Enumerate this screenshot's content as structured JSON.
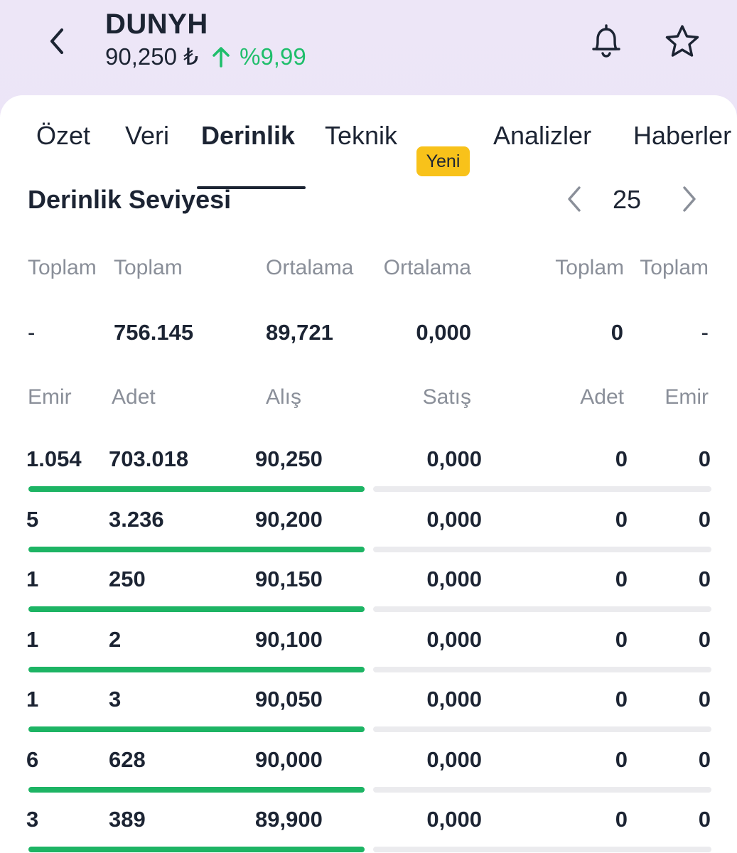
{
  "header": {
    "ticker": "DUNYH",
    "price": "90,250 ₺",
    "change": "%9,99",
    "colors": {
      "up": "#1fbe6b",
      "text": "#1c2433"
    },
    "icons": [
      "chevron-left-icon",
      "arrow-up-icon",
      "bell-icon",
      "star-icon"
    ]
  },
  "tabs": [
    {
      "label": "Özet",
      "active": false
    },
    {
      "label": "Veri",
      "active": false
    },
    {
      "label": "Derinlik",
      "active": true
    },
    {
      "label": "Teknik",
      "active": false,
      "badge": "Yeni"
    },
    {
      "label": "Analizler",
      "active": false
    },
    {
      "label": "Haberler",
      "active": false
    }
  ],
  "section": {
    "title": "Derinlik Seviyesi",
    "level": "25"
  },
  "summary": {
    "headers": [
      "Toplam",
      "Toplam",
      "Ortalama",
      "Ortalama",
      "Toplam",
      "Toplam"
    ],
    "values": [
      "-",
      "756.145",
      "89,721",
      "0,000",
      "0",
      "-"
    ]
  },
  "depth": {
    "headers": [
      "Emir",
      "Adet",
      "Alış",
      "Satış",
      "Adet",
      "Emir"
    ],
    "rows": [
      [
        "1.054",
        "703.018",
        "90,250",
        "0,000",
        "0",
        "0"
      ],
      [
        "5",
        "3.236",
        "90,200",
        "0,000",
        "0",
        "0"
      ],
      [
        "1",
        "250",
        "90,150",
        "0,000",
        "0",
        "0"
      ],
      [
        "1",
        "2",
        "90,100",
        "0,000",
        "0",
        "0"
      ],
      [
        "1",
        "3",
        "90,050",
        "0,000",
        "0",
        "0"
      ],
      [
        "6",
        "628",
        "90,000",
        "0,000",
        "0",
        "0"
      ],
      [
        "3",
        "389",
        "89,900",
        "0,000",
        "0",
        "0"
      ]
    ],
    "bar_colors": {
      "bid": "#1db464",
      "ask": "#ebebee"
    }
  }
}
